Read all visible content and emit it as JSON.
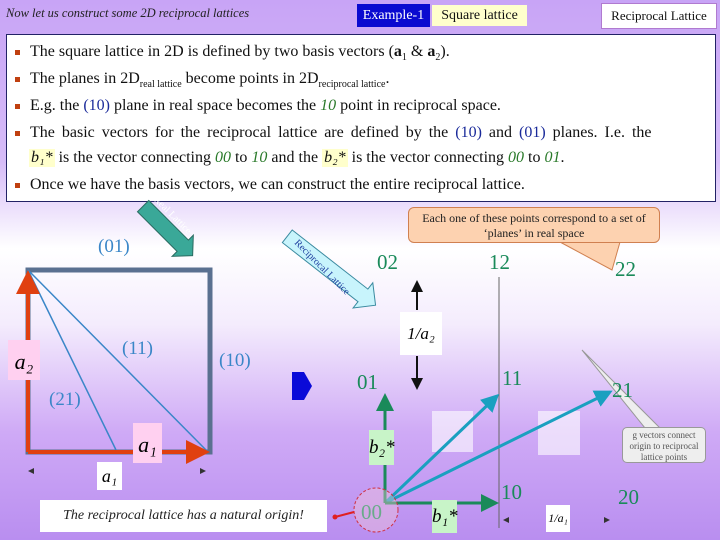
{
  "header": {
    "title": "Now let us construct some 2D reciprocal lattices",
    "example_label": "Example-1",
    "example_name": "Square lattice",
    "section_button": "Reciprocal Lattice"
  },
  "bullets": {
    "b1": {
      "t1": "The square lattice in 2D is defined by two basis vectors (",
      "a1": "a",
      "s1": "1",
      "amp": " & ",
      "a2": "a",
      "s2": "2",
      "t2": ")."
    },
    "b2": {
      "t1": "The planes in 2D",
      "s1": "real lattice",
      "t2": " become points in 2D",
      "s2": "reciprocal lattice",
      "t3": "."
    },
    "b3": {
      "t1": "E.g. the ",
      "p": "(10)",
      "t2": " plane in real space becomes the ",
      "pt": "10",
      "t3": " point in reciprocal space."
    },
    "b4": {
      "t1": "The basic vectors for the reciprocal lattice are defined by the ",
      "p1": "(10)",
      "t2": " and ",
      "p2": "(01)",
      "t3": " planes. I.e. the"
    },
    "b4b": {
      "v1": "b₁*",
      "t1": " is the vector connecting ",
      "o1": "00",
      "t2": " to ",
      "e1": "10",
      "t3": " and the ",
      "v2": "b₂*",
      "t4": " is the vector connecting ",
      "o2": "00",
      "t5": " to ",
      "e2": "01",
      "t6": "."
    },
    "b5": {
      "t1": "Once we have the basis vectors, we can construct the entire reciprocal lattice."
    }
  },
  "real": {
    "arrow_label": "Real Lattice",
    "planes": [
      "(01)",
      "(11)",
      "(10)",
      "(21)"
    ],
    "a2": "a₂",
    "a1": "a₁",
    "a1_scalar": "a₁"
  },
  "recip": {
    "arrow_label": "Reciprocal Lattice",
    "points": [
      "02",
      "12",
      "22",
      "01",
      "11",
      "21",
      "00",
      "10",
      "20"
    ],
    "b2": "b₂*",
    "b1": "b₁*",
    "inv_a2": "1/a₂",
    "inv_a1": "1/a₁"
  },
  "callouts": {
    "points": "Each one of these points correspond to a set of ‘planes’ in real space",
    "gvectors": "g vectors connect origin to reciprocal lattice points",
    "caption": "The reciprocal lattice has a natural origin!"
  },
  "colors": {
    "accent": "#0a0ad0",
    "lattice_vector": "#e04010",
    "plane": "#3a86c8",
    "recip_point": "#1a8a5a",
    "g_vector": "#1aa0c0"
  }
}
